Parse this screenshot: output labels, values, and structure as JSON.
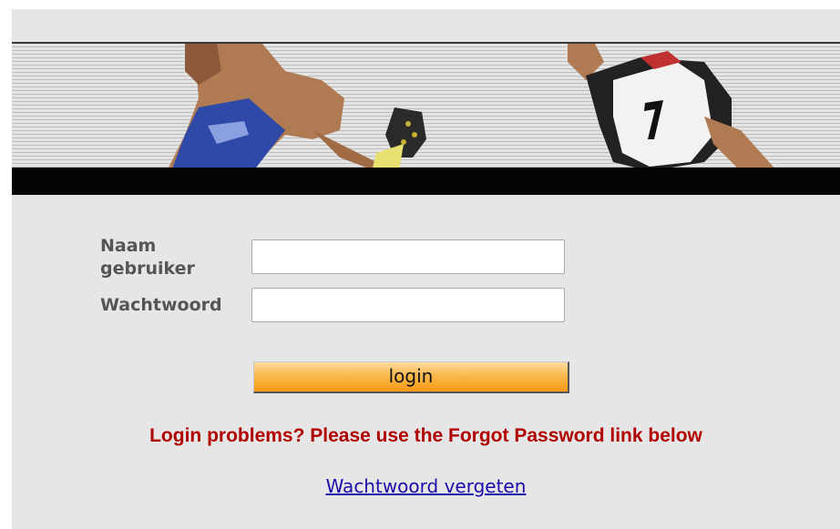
{
  "login_form": {
    "username_label": "Naam gebruiker",
    "password_label": "Wachtwoord",
    "username_value": "",
    "password_value": "",
    "login_button": "login"
  },
  "help_message": "Login problems? Please use the Forgot Password link below",
  "forgot_password_link": "Wachtwoord vergeten",
  "colors": {
    "page_background": "#e6e6e6",
    "help_text": "#b00000",
    "link": "#1a0dab",
    "button_orange": "#f59a12"
  }
}
